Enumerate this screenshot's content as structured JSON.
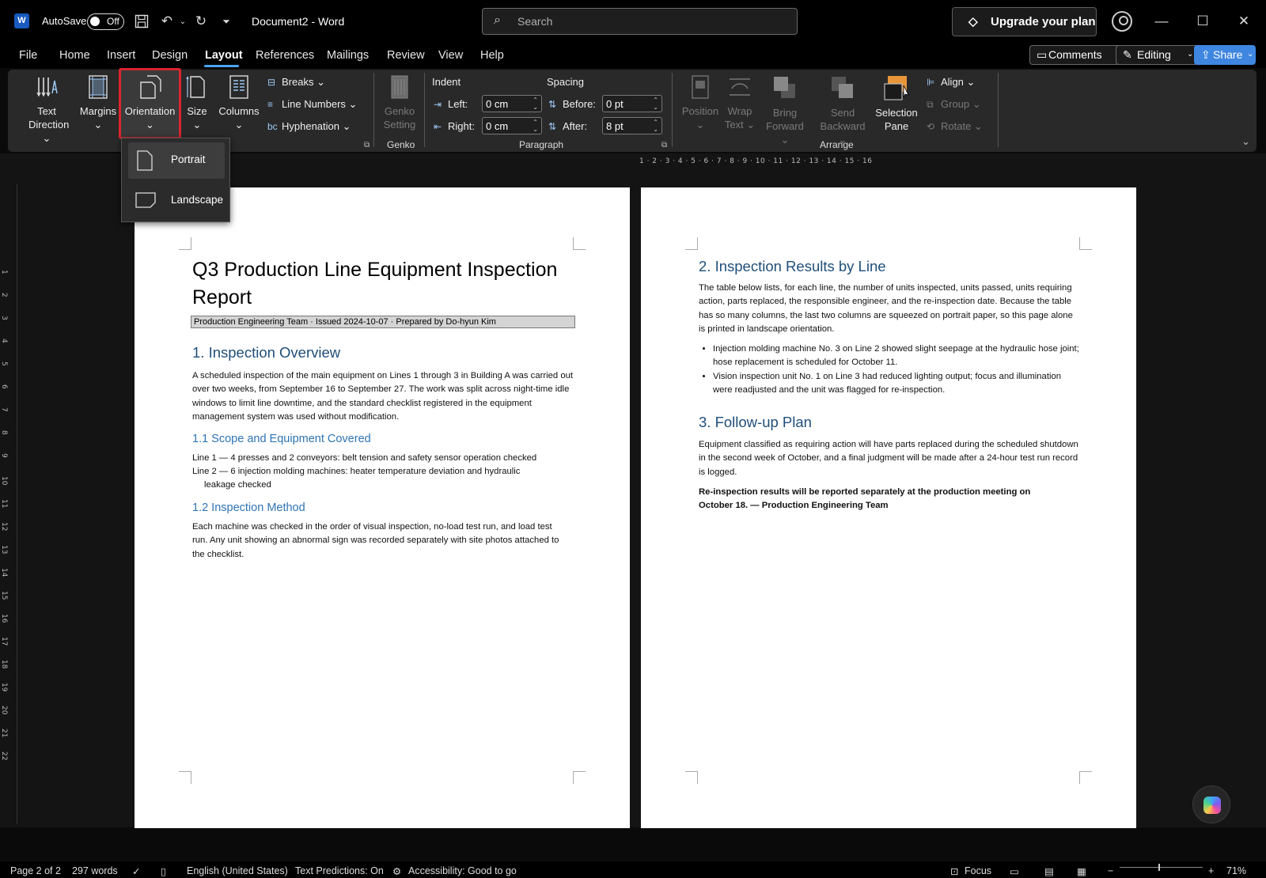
{
  "titlebar": {
    "autosave_label": "AutoSave",
    "autosave_state": "Off",
    "document_title": "Document2  -  Word",
    "search_placeholder": "Search",
    "upgrade_label": "Upgrade your plan"
  },
  "menu": {
    "tabs": [
      "File",
      "Home",
      "Insert",
      "Design",
      "Layout",
      "References",
      "Mailings",
      "Review",
      "View",
      "Help"
    ],
    "active_tab": "Layout",
    "comments_label": "Comments",
    "editing_label": "Editing",
    "share_label": "Share"
  },
  "ribbon": {
    "page_setup": {
      "text_direction": [
        "Text",
        "Direction"
      ],
      "margins": "Margins",
      "orientation": "Orientation",
      "size": "Size",
      "columns": "Columns",
      "breaks": "Breaks",
      "line_numbers": "Line Numbers",
      "hyphenation": "Hyphenation"
    },
    "genko": {
      "button": [
        "Genko",
        "Setting"
      ],
      "group_label": "Genko"
    },
    "paragraph": {
      "indent_label": "Indent",
      "spacing_label": "Spacing",
      "left_label": "Left:",
      "left_value": "0 cm",
      "right_label": "Right:",
      "right_value": "0 cm",
      "before_label": "Before:",
      "before_value": "0 pt",
      "after_label": "After:",
      "after_value": "8 pt",
      "group_label": "Paragraph"
    },
    "arrange": {
      "position": "Position",
      "wrap_text": [
        "Wrap",
        "Text"
      ],
      "bring_forward": [
        "Bring",
        "Forward"
      ],
      "send_backward": [
        "Send",
        "Backward"
      ],
      "selection_pane": [
        "Selection",
        "Pane"
      ],
      "align": "Align",
      "group": "Group",
      "rotate": "Rotate",
      "group_label": "Arrange"
    }
  },
  "orientation_dropdown": {
    "items": [
      "Portrait",
      "Landscape"
    ]
  },
  "page1": {
    "title": "Q3 Production Line Equipment Inspection Report",
    "subtitle": "Production Engineering Team · Issued 2024-10-07 · Prepared by Do-hyun Kim",
    "h1_overview": "1. Inspection Overview",
    "overview_text": "A scheduled inspection of the main equipment on Lines 1 through 3 in Building A was carried out over two weeks, from September 16 to September 27. The work was split across night-time idle windows to limit line downtime, and the standard checklist registered in the equipment management system was used without modification.",
    "h2_scope": "1.1 Scope and Equipment Covered",
    "scope_line1": "Line 1 — 4 presses and 2 conveyors: belt tension and safety sensor operation checked",
    "scope_line2a": "Line 2 — 6 injection molding machines: heater temperature deviation and hydraulic",
    "scope_line2b": "leakage checked",
    "h2_method": "1.2 Inspection Method",
    "method_text": "Each machine was checked in the order of visual inspection, no-load test run, and load test run. Any unit showing an abnormal sign was recorded separately with site photos attached to the checklist."
  },
  "page2": {
    "h1_results": "2. Inspection Results by Line",
    "results_text": "The table below lists, for each line, the number of units inspected, units passed, units requiring action, parts replaced, the responsible engineer, and the re-inspection date. Because the table has so many columns, the last two columns are squeezed on portrait paper, so this page alone is printed in landscape orientation.",
    "bullets": [
      "Injection molding machine No. 3 on Line 2 showed slight seepage at the hydraulic hose joint; hose replacement is scheduled for October 11.",
      "Vision inspection unit No. 1 on Line 3 had reduced lighting output; focus and illumination were readjusted and the unit was flagged for re-inspection."
    ],
    "h1_followup": "3. Follow-up Plan",
    "followup_text": "Equipment classified as requiring action will have parts replaced during the scheduled shutdown in the second week of October, and a final judgment will be made after a 24-hour test run record is logged.",
    "closing_text": "Re-inspection results will be reported separately at the production meeting on October 18. — Production Engineering Team"
  },
  "ruler": {
    "h_numbers": "1 · 2 · 3 · 4 · 5 · 6 · 7 · 8 · 9 · 10 · 11 · 12 · 13 · 14 · 15 · 16",
    "v_numbers": [
      "1",
      "2",
      "3",
      "4",
      "5",
      "6",
      "7",
      "8",
      "9",
      "10",
      "11",
      "12",
      "13",
      "14",
      "15",
      "16",
      "17",
      "18",
      "19",
      "20",
      "21",
      "22"
    ]
  },
  "statusbar": {
    "page": "Page 2 of 2",
    "words": "297 words",
    "language": "English (United States)",
    "predictions": "Text Predictions: On",
    "accessibility": "Accessibility: Good to go",
    "focus": "Focus",
    "zoom": "71%"
  },
  "colors": {
    "accent": "#4aa3f0",
    "highlight_box": "#d9252f",
    "heading_blue": "#1f4e79",
    "share_blue": "#3e86e0"
  }
}
